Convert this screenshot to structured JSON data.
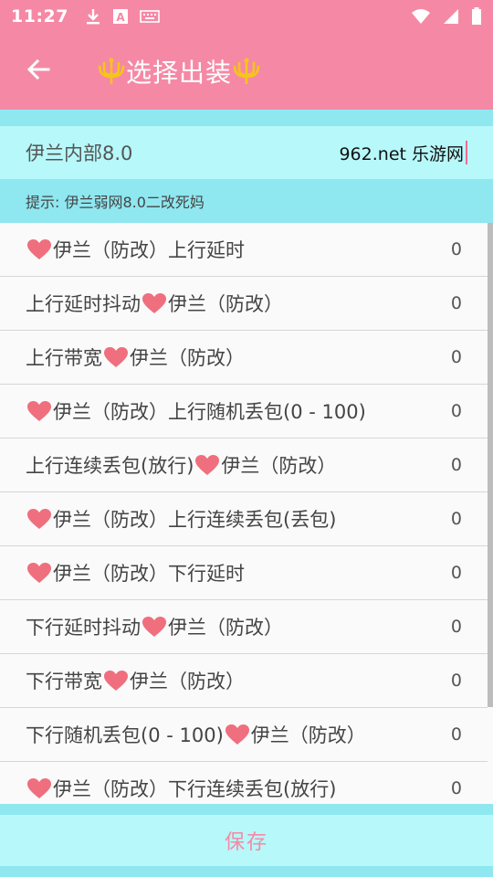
{
  "status_bar": {
    "time": "11:27",
    "icons_left": [
      "download-icon",
      "a-box-icon",
      "keyboard-icon"
    ],
    "icons_right": [
      "wifi-icon",
      "signal-icon",
      "battery-icon"
    ]
  },
  "app_bar": {
    "title": "选择出装",
    "back_icon": "arrow-back-icon",
    "title_decoration_icon": "trident-icon"
  },
  "input": {
    "label": "伊兰内部8.0",
    "value": "962.net 乐游网"
  },
  "hint": "提示: 伊兰弱网8.0二改死妈",
  "list": {
    "items": [
      {
        "pre": true,
        "label": "伊兰（防改）上行延时",
        "value": "0"
      },
      {
        "pre": false,
        "label": "上行延时抖动",
        "suffix": "伊兰（防改）",
        "value": "0"
      },
      {
        "pre": false,
        "label": "上行带宽",
        "suffix": "伊兰（防改）",
        "value": "0"
      },
      {
        "pre": true,
        "label": "伊兰（防改）上行随机丢包(0 - 100)",
        "value": "0"
      },
      {
        "pre": false,
        "label": "上行连续丢包(放行)",
        "suffix": "伊兰（防改）",
        "value": "0"
      },
      {
        "pre": true,
        "label": "伊兰（防改）上行连续丢包(丢包)",
        "value": "0"
      },
      {
        "pre": true,
        "label": "伊兰（防改）下行延时",
        "value": "0"
      },
      {
        "pre": false,
        "label": "下行延时抖动",
        "suffix": "伊兰（防改）",
        "value": "0"
      },
      {
        "pre": false,
        "label": "下行带宽",
        "suffix": "伊兰（防改）",
        "value": "0"
      },
      {
        "pre": false,
        "label": "下行随机丢包(0 - 100)",
        "suffix": "伊兰（防改）",
        "value": "0"
      },
      {
        "pre": true,
        "label": "伊兰（防改）下行连续丢包(放行)",
        "value": "0"
      }
    ]
  },
  "save_button": {
    "label": "保存"
  },
  "colors": {
    "primary": "#f589a5",
    "light_cyan": "#b7f8fa",
    "cyan": "#8fe7f0",
    "heart": "#ef6f7e"
  }
}
